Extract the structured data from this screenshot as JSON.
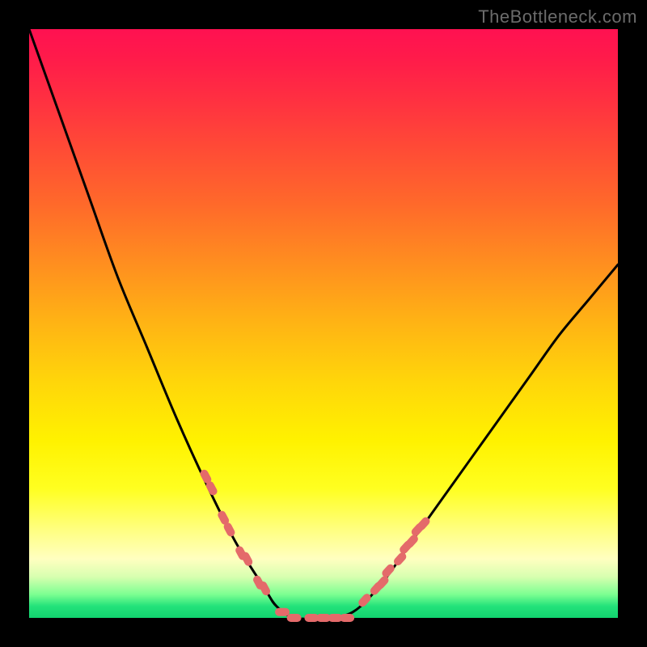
{
  "watermark": "TheBottleneck.com",
  "chart_data": {
    "type": "line",
    "title": "",
    "xlabel": "",
    "ylabel": "",
    "xlim": [
      0,
      100
    ],
    "ylim": [
      0,
      100
    ],
    "grid": false,
    "legend": false,
    "series": [
      {
        "name": "bottleneck-curve",
        "color": "#000000",
        "x": [
          0,
          5,
          10,
          15,
          20,
          25,
          30,
          35,
          40,
          42,
          45,
          50,
          55,
          60,
          65,
          70,
          75,
          80,
          85,
          90,
          95,
          100
        ],
        "values": [
          100,
          86,
          72,
          58,
          46,
          34,
          23,
          13,
          5,
          2,
          0,
          0,
          1,
          6,
          13,
          20,
          27,
          34,
          41,
          48,
          54,
          60
        ]
      }
    ],
    "markers": [
      {
        "name": "left-cluster",
        "color": "#e46a6a",
        "shape": "capsule",
        "points": [
          {
            "x": 30,
            "y": 24
          },
          {
            "x": 31,
            "y": 22
          },
          {
            "x": 33,
            "y": 17
          },
          {
            "x": 34,
            "y": 15
          },
          {
            "x": 36,
            "y": 11
          },
          {
            "x": 37,
            "y": 10
          },
          {
            "x": 39,
            "y": 6
          },
          {
            "x": 40,
            "y": 5
          }
        ]
      },
      {
        "name": "bottom-cluster",
        "color": "#e46a6a",
        "shape": "capsule",
        "points": [
          {
            "x": 43,
            "y": 1
          },
          {
            "x": 45,
            "y": 0
          },
          {
            "x": 48,
            "y": 0
          },
          {
            "x": 50,
            "y": 0
          },
          {
            "x": 52,
            "y": 0
          },
          {
            "x": 54,
            "y": 0
          }
        ]
      },
      {
        "name": "right-cluster",
        "color": "#e46a6a",
        "shape": "capsule",
        "points": [
          {
            "x": 57,
            "y": 3
          },
          {
            "x": 59,
            "y": 5
          },
          {
            "x": 60,
            "y": 6
          },
          {
            "x": 61,
            "y": 8
          },
          {
            "x": 63,
            "y": 10
          },
          {
            "x": 64,
            "y": 12
          },
          {
            "x": 65,
            "y": 13
          },
          {
            "x": 66,
            "y": 15
          },
          {
            "x": 67,
            "y": 16
          }
        ]
      }
    ],
    "background_gradient": {
      "top": "#ff1151",
      "mid": "#ffd60a",
      "bottom": "#12d46f"
    }
  }
}
